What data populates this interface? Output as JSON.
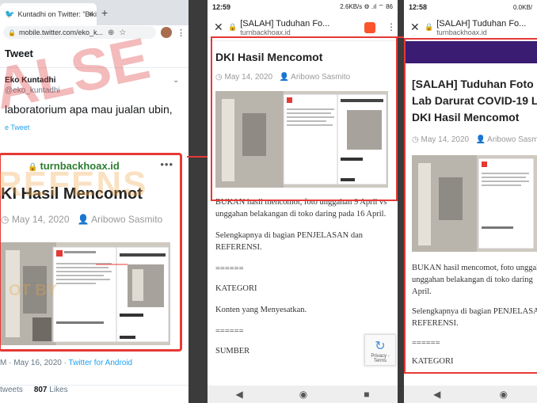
{
  "panel1": {
    "tab_title": "Kuntadhi on Twitter: \"Bikin",
    "tab_close": "✕",
    "new_tab": "+",
    "url": "mobile.twitter.com/eko_k...",
    "header": "Tweet",
    "user_name": "Eko Kuntadhi",
    "user_handle": "@eko_kuntadhi",
    "tweet_text": "laboratorium apa mau jualan ubin,",
    "translate": "e Tweet",
    "stamp_text": "ALSE",
    "card_domain": "turnbackhoax.id",
    "card_title": "KI Hasil Mencomot",
    "card_date": "May 14, 2020",
    "card_author": "Aribowo Sasmito",
    "date_line": "M · May 16, 2020 · ",
    "source": "Twitter for Android",
    "retweets": "tweets",
    "likes_count": "807",
    "likes_label": "Likes"
  },
  "panel2": {
    "time": "12:59",
    "status_right": "2.6KB/s ⚙ .ıl ⌔ 86",
    "page_title": "[SALAH] Tuduhan Fo...",
    "page_domain": "turnbackhoax.id",
    "article_title": "DKI Hasil Mencomot",
    "date": "May 14, 2020",
    "author": "Aribowo Sasmito",
    "para1": "BUKAN hasil mencomot, foto unggahan 9 April vs unggahan belakangan di toko daring pada 16 April.",
    "para2": "Selengkapnya di bagian PENJELASAN dan REFERENSI.",
    "sep1": "======",
    "kategori": "KATEGORI",
    "kategori_val": "Konten yang Menyesatkan.",
    "sep2": "======",
    "sumber": "SUMBER",
    "recaptcha": "Privacy - Terms"
  },
  "panel3": {
    "time": "12:58",
    "status_right": "0.0KB/",
    "page_title": "[SALAH] Tuduhan Fo...",
    "page_domain": "turnbackhoax.id",
    "title_l1": "[SALAH] Tuduhan Foto In",
    "title_l2": "Lab Darurat COVID-19 La",
    "title_l3": "DKI Hasil Mencomot",
    "date": "May 14, 2020",
    "author": "Aribowo Sasmito",
    "para1_l1": "BUKAN hasil mencomot, foto unggah",
    "para1_l2": "unggahan belakangan di toko daring",
    "para1_l3": "April.",
    "para2_l1": "Selengkapnya di bagian PENJELASAN",
    "para2_l2": "REFERENSI.",
    "sep": "======",
    "kategori": "KATEGORI"
  },
  "colors": {
    "highlight": "#e53935",
    "twitter_blue": "#1da1f2",
    "hoax_green": "#2e7d32"
  }
}
